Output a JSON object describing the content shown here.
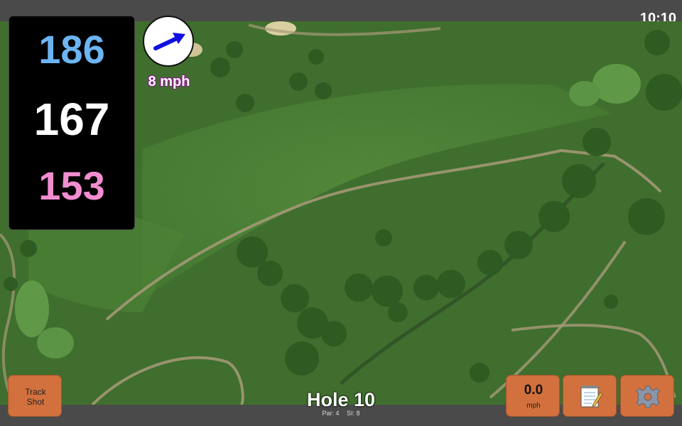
{
  "status": {
    "time": "10:10"
  },
  "distances": {
    "back": "186",
    "middle": "167",
    "front": "153"
  },
  "wind": {
    "speed": "8 mph",
    "icon": "wind-arrow-icon"
  },
  "track_button": {
    "line1": "Track",
    "line2": "Shot"
  },
  "hole": {
    "title": "Hole 10",
    "par": "Par: 4",
    "si": "SI: 8"
  },
  "speed_button": {
    "value": "0.0",
    "unit": "mph"
  },
  "notes_button": {
    "icon": "notepad-icon"
  },
  "settings_button": {
    "icon": "gear-icon"
  },
  "colors": {
    "back": "#6cb4f2",
    "middle": "#ffffff",
    "front": "#f28ed0",
    "button": "#d2713e",
    "wind_arrow": "#1010e0"
  }
}
